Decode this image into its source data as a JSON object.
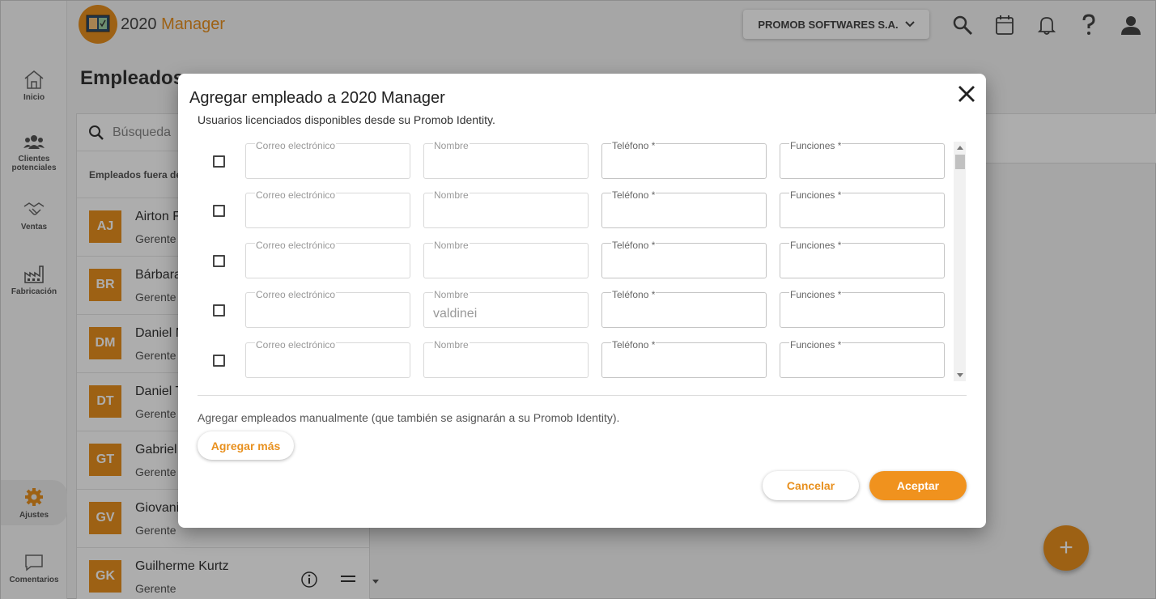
{
  "app": {
    "logo_prefix": "2020",
    "logo_suffix": "Manager",
    "company": "PROMOB SOFTWARES S.A.",
    "page_title": "Empleados"
  },
  "sidebar": {
    "items": [
      {
        "label": "Inicio",
        "icon": "home-icon"
      },
      {
        "label": "Clientes potenciales",
        "icon": "people-icon"
      },
      {
        "label": "Ventas",
        "icon": "handshake-icon"
      },
      {
        "label": "Fabricación",
        "icon": "factory-icon"
      },
      {
        "label": "Ajustes",
        "icon": "gear-icon"
      },
      {
        "label": "Comentarios",
        "icon": "comment-icon"
      }
    ]
  },
  "employees": {
    "search_placeholder": "Búsqueda",
    "section_label": "Empleados fuera de",
    "rows": [
      {
        "initials": "AJ",
        "name": "Airton F",
        "role": "Gerente"
      },
      {
        "initials": "BR",
        "name": "Bárbara",
        "role": "Gerente"
      },
      {
        "initials": "DM",
        "name": "Daniel M",
        "role": "Gerente"
      },
      {
        "initials": "DT",
        "name": "Daniel T",
        "role": "Gerente"
      },
      {
        "initials": "GT",
        "name": "Gabriel",
        "role": "Gerente"
      },
      {
        "initials": "GV",
        "name": "Giovani",
        "role": "Gerente"
      },
      {
        "initials": "GK",
        "name": "Guilherme Kurtz",
        "role": "Gerente"
      }
    ]
  },
  "modal": {
    "title": "Agregar empleado a 2020 Manager",
    "subtitle": "Usuarios licenciados disponibles desde su Promob Identity.",
    "field_labels": {
      "email": "Correo electrónico",
      "name": "Nombre",
      "phone": "Teléfono *",
      "roles": "Funciones *"
    },
    "rows": [
      {
        "email": "",
        "name": "",
        "phone": "",
        "roles": ""
      },
      {
        "email": "",
        "name": "",
        "phone": "",
        "roles": ""
      },
      {
        "email": "",
        "name": "",
        "phone": "",
        "roles": ""
      },
      {
        "email": "",
        "name": "valdinei",
        "phone": "",
        "roles": ""
      },
      {
        "email": "",
        "name": "",
        "phone": "",
        "roles": ""
      }
    ],
    "manual_text": "Agregar empleados manualmente (que también se asignarán a su Promob Identity).",
    "add_more_label": "Agregar más",
    "cancel_label": "Cancelar",
    "accept_label": "Aceptar"
  },
  "colors": {
    "accent": "#e8901e"
  }
}
